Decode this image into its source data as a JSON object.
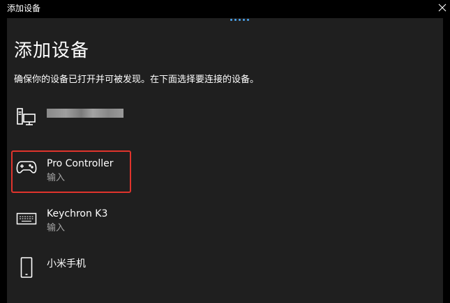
{
  "window": {
    "title": "添加设备",
    "close_icon": "close-icon"
  },
  "page": {
    "title": "添加设备",
    "subtitle": "确保你的设备已打开并可被发现。在下面选择要连接的设备。"
  },
  "colors": {
    "background": "#1f1f1f",
    "titlebar": "#000000",
    "text": "#ffffff",
    "secondary_text": "#a6a6a6",
    "accent": "#4ea6f2",
    "highlight": "#e0342c"
  },
  "devices": [
    {
      "icon": "computer-icon",
      "name": "",
      "type": "",
      "redacted": true
    },
    {
      "icon": "gamepad-icon",
      "name": "Pro Controller",
      "type": "输入",
      "highlighted": true
    },
    {
      "icon": "keyboard-icon",
      "name": "Keychron K3",
      "type": "输入"
    },
    {
      "icon": "phone-icon",
      "name": "小米手机",
      "type": ""
    }
  ]
}
